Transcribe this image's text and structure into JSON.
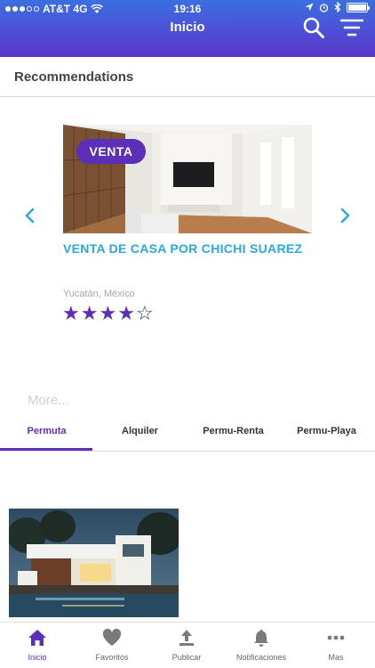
{
  "status_bar": {
    "carrier": "AT&T 4G",
    "time": "19:16"
  },
  "header": {
    "title": "Inicio"
  },
  "recommendations": {
    "title": "Recommendations",
    "badge": "VENTA",
    "listing_title": "VENTA DE CASA POR CHICHI SUAREZ",
    "location": "Yucatán, México",
    "rating": 4,
    "rating_max": 5,
    "more_label": "More..."
  },
  "tabs": [
    {
      "label": "Permuta",
      "active": true
    },
    {
      "label": "Alquiler",
      "active": false
    },
    {
      "label": "Permu-Renta",
      "active": false
    },
    {
      "label": "Permu-Playa",
      "active": false
    }
  ],
  "tabbar": [
    {
      "label": "Inicio",
      "icon": "home-icon",
      "active": true
    },
    {
      "label": "Favoritos",
      "icon": "heart-icon",
      "active": false
    },
    {
      "label": "Publicar",
      "icon": "upload-icon",
      "active": false
    },
    {
      "label": "Notificaciones",
      "icon": "bell-icon",
      "active": false
    },
    {
      "label": "Mas",
      "icon": "more-icon",
      "active": false
    }
  ],
  "colors": {
    "accent": "#5b2fb8",
    "link": "#2ba7e0",
    "header_top": "#3a6fe0",
    "header_bottom": "#5a36c8"
  }
}
